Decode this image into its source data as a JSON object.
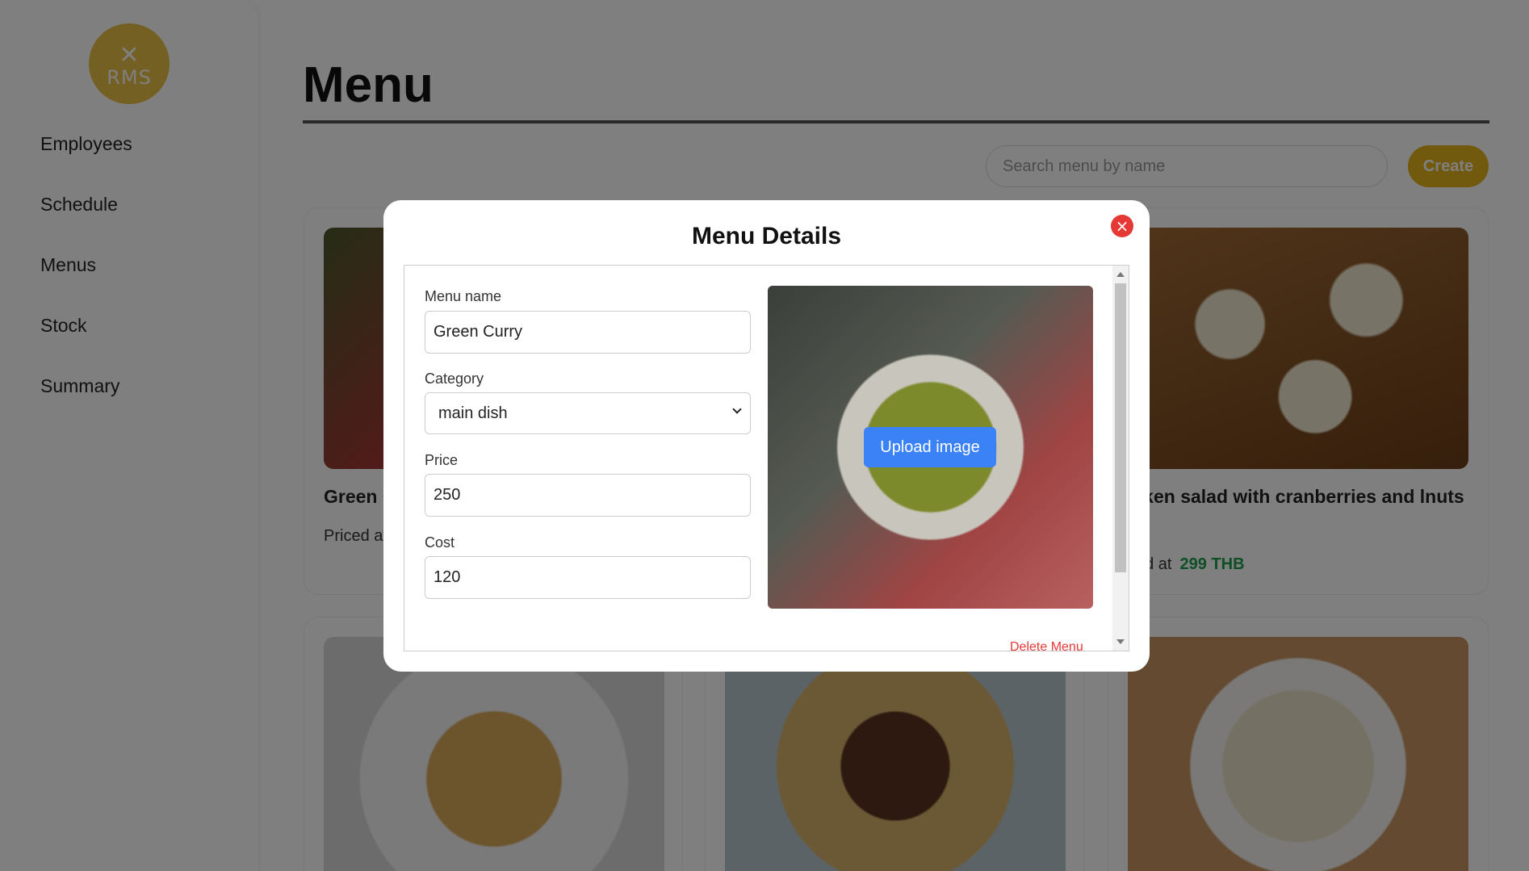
{
  "sidebar": {
    "logo_text": "RMS",
    "items": [
      {
        "label": "Employees"
      },
      {
        "label": "Schedule"
      },
      {
        "label": "Menus"
      },
      {
        "label": "Stock"
      },
      {
        "label": "Summary"
      }
    ]
  },
  "main": {
    "title": "Menu",
    "search_placeholder": "Search menu by name",
    "create_label": "Create",
    "cards": [
      {
        "name": "Green C",
        "price_label": "Priced at",
        "price": ""
      },
      {
        "name": "icken salad with cranberries and lnuts",
        "price_label": "ced at",
        "price": "299 THB"
      }
    ]
  },
  "modal": {
    "title": "Menu Details",
    "fields": {
      "name_label": "Menu name",
      "name_value": "Green Curry",
      "category_label": "Category",
      "category_value": "main dish",
      "price_label": "Price",
      "price_value": "250",
      "cost_label": "Cost",
      "cost_value": "120"
    },
    "upload_label": "Upload image",
    "delete_label": "Delete Menu"
  },
  "colors": {
    "accent": "#e3b21c",
    "price_green": "#1e9e4a",
    "danger": "#e53935",
    "upload_blue": "#3b82f6"
  }
}
